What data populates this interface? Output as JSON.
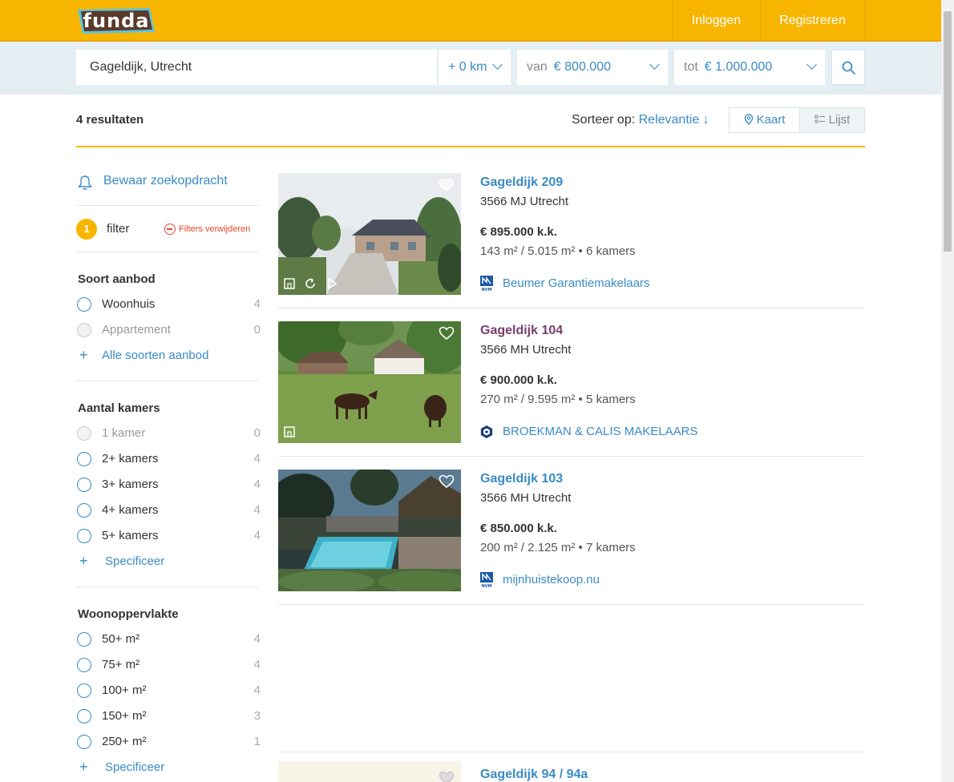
{
  "header": {
    "logo": "funda",
    "login": "Inloggen",
    "register": "Registreren"
  },
  "search": {
    "location": "Gageldijk, Utrecht",
    "radius": "+ 0 km",
    "price_from_prefix": "van",
    "price_from": "€ 800.000",
    "price_to_prefix": "tot",
    "price_to": "€ 1.000.000"
  },
  "results": {
    "count": "4 resultaten",
    "sort_label": "Sorteer op:",
    "sort_value": "Relevantie ↓",
    "view_map": "Kaart",
    "view_list": "Lijst"
  },
  "sidebar": {
    "save_search": "Bewaar zoekopdracht",
    "filter_count": "1",
    "filter_label": "filter",
    "filter_clear": "Filters verwijderen",
    "soort": {
      "title": "Soort aanbod",
      "options": [
        {
          "label": "Woonhuis",
          "count": "4"
        },
        {
          "label": "Appartement",
          "count": "0"
        }
      ],
      "more": "Alle soorten aanbod"
    },
    "kamers": {
      "title": "Aantal kamers",
      "options": [
        {
          "label": "1 kamer",
          "count": "0"
        },
        {
          "label": "2+ kamers",
          "count": "4"
        },
        {
          "label": "3+ kamers",
          "count": "4"
        },
        {
          "label": "4+ kamers",
          "count": "4"
        },
        {
          "label": "5+ kamers",
          "count": "4"
        }
      ],
      "more": "Specificeer"
    },
    "woonopp": {
      "title": "Woonoppervlakte",
      "options": [
        {
          "label": "50+ m²",
          "count": "4"
        },
        {
          "label": "75+ m²",
          "count": "4"
        },
        {
          "label": "100+ m²",
          "count": "4"
        },
        {
          "label": "150+ m²",
          "count": "3"
        },
        {
          "label": "250+ m²",
          "count": "1"
        }
      ],
      "more": "Specificeer"
    }
  },
  "listings": [
    {
      "title": "Gageldijk 209",
      "zip": "3566 MJ Utrecht",
      "price": "€ 895.000 k.k.",
      "specs": "143 m² / 5.015 m² • 6 kamers",
      "agent": "Beumer Garantiemakelaars"
    },
    {
      "title": "Gageldijk 104",
      "zip": "3566 MH Utrecht",
      "price": "€ 900.000 k.k.",
      "specs": "270 m² / 9.595 m² • 5 kamers",
      "agent": "BROEKMAN & CALIS MAKELAARS"
    },
    {
      "title": "Gageldijk 103",
      "zip": "3566 MH Utrecht",
      "price": "€ 850.000 k.k.",
      "specs": "200 m² / 2.125 m² • 7 kamers",
      "agent": "mijnhuistekoop.nu"
    },
    {
      "title": "Gageldijk 94 / 94a"
    }
  ],
  "colors": {
    "brand": "#f7b500",
    "link": "#3a8bc6",
    "visited": "#7a3d6e"
  }
}
